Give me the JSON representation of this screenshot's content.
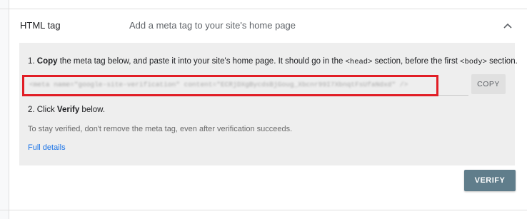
{
  "method": {
    "title": "HTML tag",
    "description": "Add a meta tag to your site's home page",
    "collapse_icon": "chevron-up-icon"
  },
  "step1": {
    "prefix": "1. ",
    "bold": "Copy",
    "text_a": " the meta tag below, and paste it into your site's home page. It should go in the ",
    "code_head": "<head>",
    "text_b": " section, before the first ",
    "code_body": "<body>",
    "text_c": " section."
  },
  "meta_tag": {
    "value": "<meta name=\"google-site-verification\" content=\"ECRjDXgBycdsBjGoug_Xbcnr99I7XbnqtFsUfaNdxd\" />"
  },
  "copy_button": {
    "label": "COPY"
  },
  "step2": {
    "prefix": "2. Click ",
    "bold": "Verify",
    "suffix": " below."
  },
  "note": "To stay verified, don't remove the meta tag, even after verification succeeds.",
  "full_details_link": "Full details",
  "verify_button": {
    "label": "VERIFY"
  },
  "colors": {
    "panel_background": "#eeeeee",
    "verify_button": "#607d8b",
    "link": "#1a73e8",
    "highlight_border": "#e11d25"
  }
}
